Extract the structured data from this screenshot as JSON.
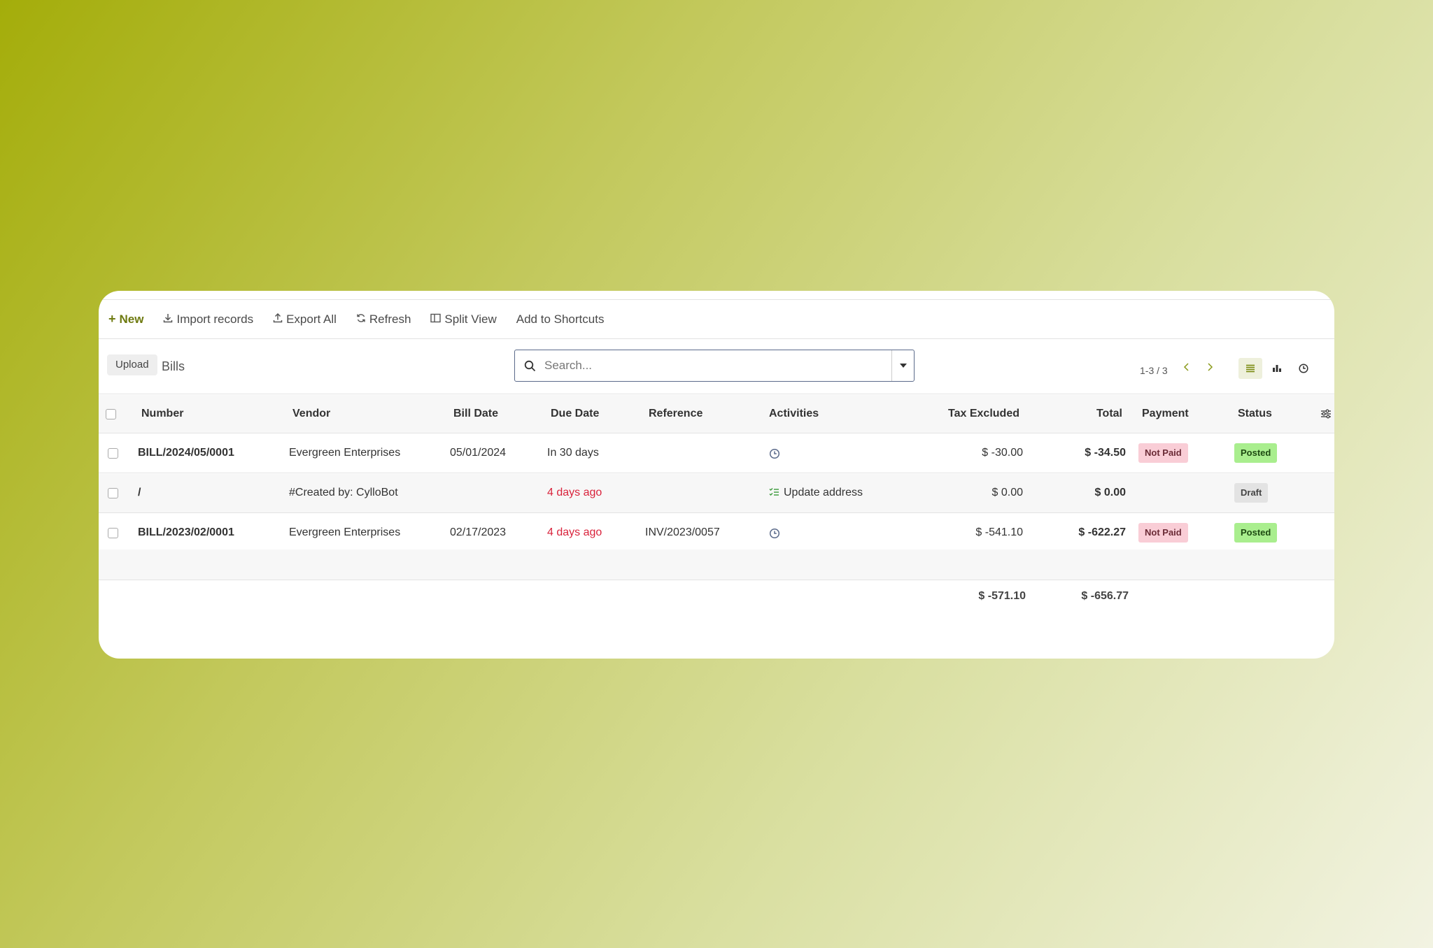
{
  "toolbar": {
    "new_label": "New",
    "import_label": "Import records",
    "export_label": "Export All",
    "refresh_label": "Refresh",
    "split_label": "Split View",
    "shortcuts_label": "Add to Shortcuts"
  },
  "control": {
    "upload_label": "Upload",
    "title": "Bills",
    "search_placeholder": "Search...",
    "pager_text": "1-3 / 3"
  },
  "columns": {
    "number": "Number",
    "vendor": "Vendor",
    "bill_date": "Bill Date",
    "due_date": "Due Date",
    "reference": "Reference",
    "activities": "Activities",
    "tax_excluded": "Tax Excluded",
    "total": "Total",
    "payment": "Payment",
    "status": "Status"
  },
  "rows": [
    {
      "number": "BILL/2024/05/0001",
      "vendor": "Evergreen Enterprises",
      "bill_date": "05/01/2024",
      "due_date": "In 30 days",
      "due_overdue": false,
      "reference": "",
      "activity": "",
      "tax_excluded": "$ -30.00",
      "total": "$ -34.50",
      "payment": "Not Paid",
      "status": "Posted"
    },
    {
      "number": "/",
      "vendor": "#Created by: CylloBot",
      "bill_date": "",
      "due_date": "4 days ago",
      "due_overdue": true,
      "reference": "",
      "activity": "Update address",
      "tax_excluded": "$ 0.00",
      "total": "$ 0.00",
      "payment": "",
      "status": "Draft"
    },
    {
      "number": "BILL/2023/02/0001",
      "vendor": "Evergreen Enterprises",
      "bill_date": "02/17/2023",
      "due_date": "4 days ago",
      "due_overdue": true,
      "reference": "INV/2023/0057",
      "activity": "",
      "tax_excluded": "$ -541.10",
      "total": "$ -622.27",
      "payment": "Not Paid",
      "status": "Posted"
    }
  ],
  "totals": {
    "tax_excluded": "$ -571.10",
    "total": "$ -656.77"
  },
  "colors": {
    "accent": "#6e7a10",
    "overdue": "#d9233c",
    "not_paid_bg": "#f9cdd6",
    "posted_bg": "#a9ee8e",
    "draft_bg": "#e3e3e3"
  }
}
